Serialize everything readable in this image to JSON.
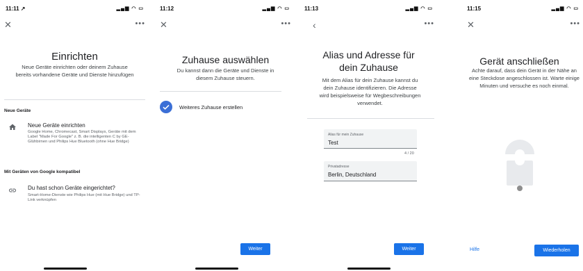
{
  "screens": [
    {
      "time": "11:11 ↗",
      "nav_icon": "close-icon",
      "title": "Einrichten",
      "description": "Neue Geräte einrichten oder deinem Zuhause bereits vorhandene Geräte und Dienste hinzufügen",
      "sections": [
        {
          "header": "Neue Geräte",
          "item": {
            "icon": "home-icon",
            "title": "Neue Geräte einrichten",
            "desc": "Google Home, Chromecast, Smart Displays, Geräte mit dem Label \"Made For Google\" z. B. die intelligenten C by GE-Glühbirnen und Philips Hue Bluetooth (ohne Hue Bridge)"
          }
        },
        {
          "header": "Mit Geräten von Google kompatibel",
          "item": {
            "icon": "link-icon",
            "title": "Du hast schon Geräte eingerichtet?",
            "desc": "Smart-Home-Dienste wie Philips Hue (mit Hue Bridge) und TP-Link verknüpfen"
          }
        }
      ]
    },
    {
      "time": "11:12",
      "nav_icon": "close-icon",
      "title": "Zuhause auswählen",
      "description": "Du kannst dann die Geräte und Dienste in diesem Zuhause steuern.",
      "option": "Weiteres Zuhause erstellen",
      "button": "Weiter"
    },
    {
      "time": "11:13",
      "nav_icon": "back-arrow-icon",
      "title": "Alias und Adresse für dein Zuhause",
      "description": "Mit dem Alias für dein Zuhause kannst du dein Zuhause identifizieren. Die Adresse wird beispielsweise für Wegbeschreibungen verwendet.",
      "alias_label": "Alias für mein Zuhause",
      "alias_value": "Test",
      "counter": "4 / 20",
      "address_label": "Privatadresse",
      "address_value": "Berlin, Deutschland",
      "button": "Weiter"
    },
    {
      "time": "11:15",
      "nav_icon": "close-icon",
      "title": "Gerät anschließen",
      "description": "Achte darauf, dass dein Gerät in der Nähe an eine Steckdose angeschlossen ist. Warte einige Minuten und versuche es noch einmal.",
      "help_link": "Hilfe",
      "button": "Wiederholen"
    }
  ],
  "status_icons": "signal-wifi-battery-icons",
  "more_icon": "more-horizontal-icon",
  "colors": {
    "accent": "#1a73e8",
    "check": "#3b6fd6",
    "divider": "#dadce0"
  }
}
